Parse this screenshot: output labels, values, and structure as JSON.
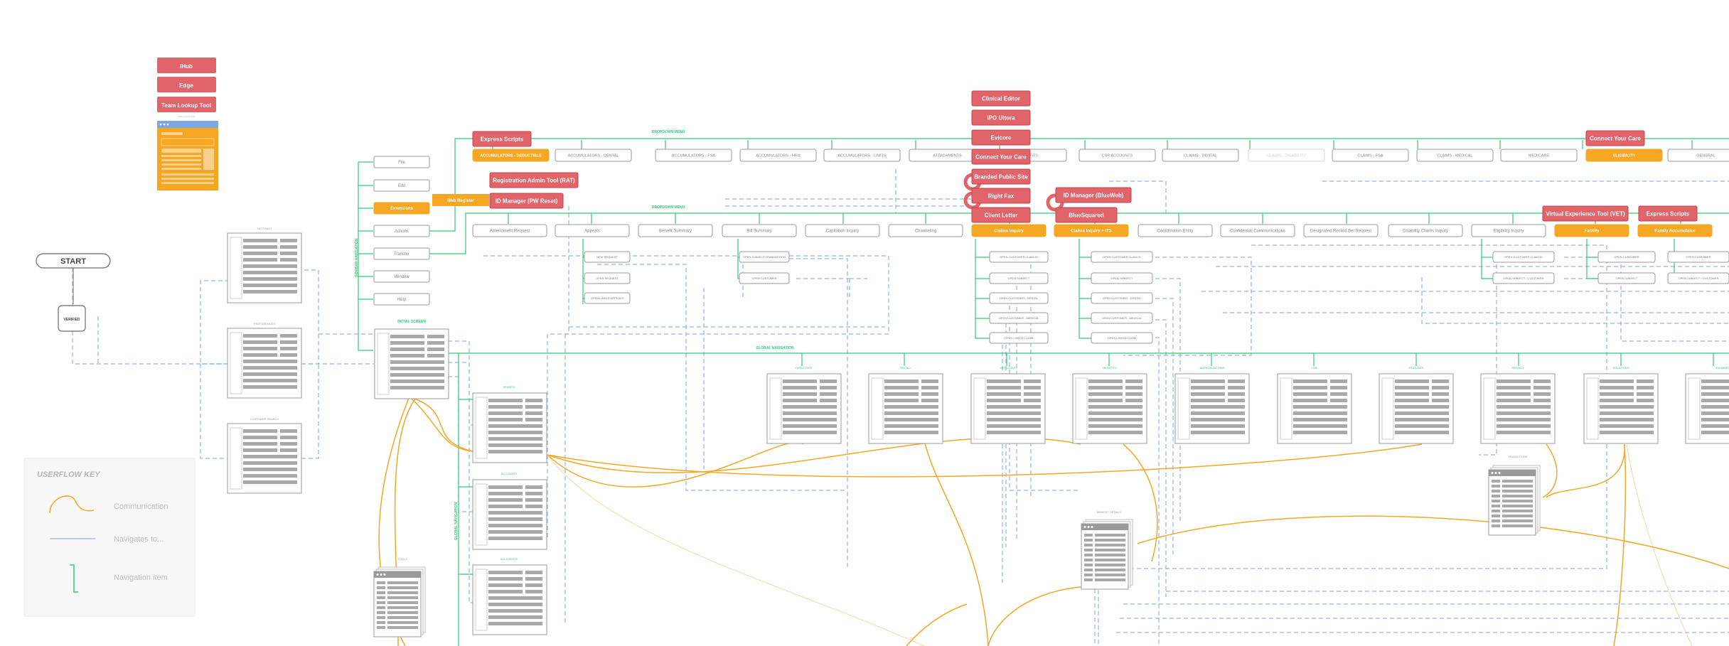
{
  "start": {
    "label": "START"
  },
  "verified": {
    "label": "VERIFIED"
  },
  "key": {
    "title": "USERFLOW KEY",
    "items": [
      "Communication",
      "Navigates to...",
      "Navigation item"
    ]
  },
  "external_tools": [
    "iHub",
    "Edge",
    "Team Lookup Tool"
  ],
  "tool_caption": "Team Lookup Tool",
  "side_nav": {
    "label": "SIDEBAR NAVIGATION",
    "items": [
      "File",
      "Edit",
      "Extensions",
      "Actions",
      "Transfer",
      "Window",
      "Help"
    ],
    "selected_index": 2
  },
  "web_register": "Web Register",
  "labels": {
    "dropdown1": "DROPDOWN MENU",
    "dropdown2": "DROPDOWN MENU",
    "global": "GLOBAL NAVIGATION",
    "global_v": "GLOBAL NAVIGATION",
    "initial": "INITIAL SCREEN",
    "search": "SEARCH",
    "accounts": "ACCOUNTS",
    "all_events": "ALL EVENTS",
    "tools": "TOOLS",
    "benefit_details": "BENEFIT DETAILS",
    "transitions": "TRANSITIONS"
  },
  "top_menu": [
    "ACCUMULATORS - DEDUCTIBLE",
    "ACCUMULATORS - DENTAL",
    "ACCUMULATORS - FSA",
    "ACCUMULATORS - HRA",
    "ACCUMULATORS - LIMITS",
    "ATTACHMENTS",
    "BENEFITS",
    "CSR ACCOUNTS",
    "CLAIMS - DENTAL",
    "CLAIMS - DISABILITY",
    "CLAIMS - FSA",
    "CLAIMS - MEDICAL",
    "MEDICARE",
    "ELIGIBILITY",
    "GENERAL"
  ],
  "mid_menu": [
    "Amendment Request",
    "Appeals",
    "Benefit Summary",
    "Bill Summary",
    "Capitation Inquiry",
    "Channeling",
    "Claims Inquiry",
    "Claims Inquiry + ITS",
    "Coordination Entity",
    "Confidential Communications",
    "Designated Record Set Request",
    "Disability Claims Inquiry",
    "Eligibility Inquiry",
    "Facility",
    "Family Accumulator"
  ],
  "red_tags": [
    "Express Scripts",
    "Registration Admin Tool (RAT)",
    "ID Manager (PW Reset)",
    "Clinical Editor",
    "IPO Ultora",
    "Evicore",
    "Connect Your Care",
    "Branded Public Site",
    "Right Fax",
    "Client Letter",
    "ID Manager (BlueWeb)",
    "BlueSquared",
    "Connect Your Care",
    "Virtual Experience Tool (VET)",
    "Express Scripts"
  ],
  "sub_items": {
    "appeals": [
      "NEW REQUEST",
      "OPEN REQUEST",
      "OPEN LINKED APPEALS"
    ],
    "bill": [
      "OPEN SUBJECT TRANSACTION",
      "OPEN CUSTOMER"
    ],
    "claims": [
      "OPEN CUSTOMER CLAIM ID",
      "OPEN SUBJECT",
      "OPEN CUSTOMER - DENTAL",
      "OPEN CUSTOMER - MEDICAL",
      "OPEN LINKED CLAIM"
    ],
    "claims_its": [
      "OPEN CUSTOMER CLAIM ID",
      "OPEN SUBJECT",
      "OPEN CUSTOMER - DENTAL",
      "OPEN CUSTOMER - MEDICAL",
      "OPEN LINKED CLAIM"
    ],
    "eligibility": [
      "OPEN CUSTOMER CLAIM ID",
      "OPEN SUBJECT / CUSTOMER"
    ],
    "facility": [
      "OPEN CUSTOMER",
      "OPEN SUBJECT"
    ],
    "family": [
      "OPEN CUSTOMER",
      "OPEN SUBJECT / CUSTOMER"
    ]
  },
  "screens_left": [
    "SETTINGS",
    "PREFERENCES",
    "CUSTOMER SEARCH"
  ],
  "global_screens": [
    "DIRECTORY",
    "RECALL",
    "APPLICANT",
    "BENEFITS",
    "AUTHORIZATIONS",
    "LINK",
    "STATUSES",
    "PRIVACY",
    "SOLUTIONS",
    "SUMMARY"
  ],
  "colors": {
    "red": "#e06469",
    "orange": "#f5a623",
    "green": "#2ecc71",
    "blue_dash": "#8db3ec",
    "node_border": "#9a9a9a",
    "bar": "#a9a9a9",
    "key_bg": "#f7f7f7"
  }
}
